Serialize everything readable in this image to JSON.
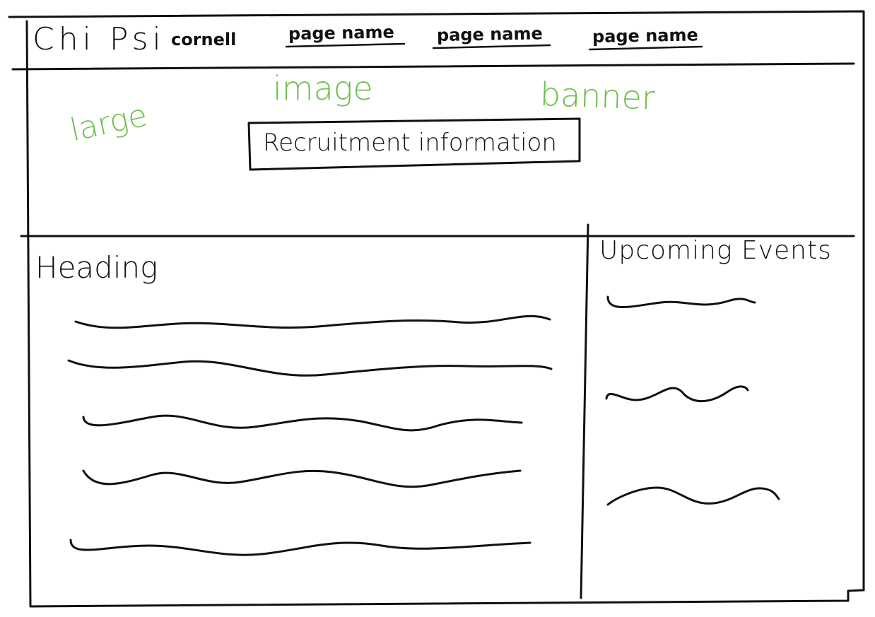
{
  "header": {
    "brand": "Chi Psi",
    "subtitle": "cornell",
    "nav": [
      "page name",
      "page name",
      "page name"
    ]
  },
  "banner": {
    "annotations": [
      "large",
      "image",
      "banner"
    ],
    "cta_label": "Recruitment information"
  },
  "main": {
    "heading": "Heading"
  },
  "sidebar": {
    "title": "Upcoming Events"
  },
  "colors": {
    "ink": "#111111",
    "annotation_green": "#6fbf4f"
  }
}
